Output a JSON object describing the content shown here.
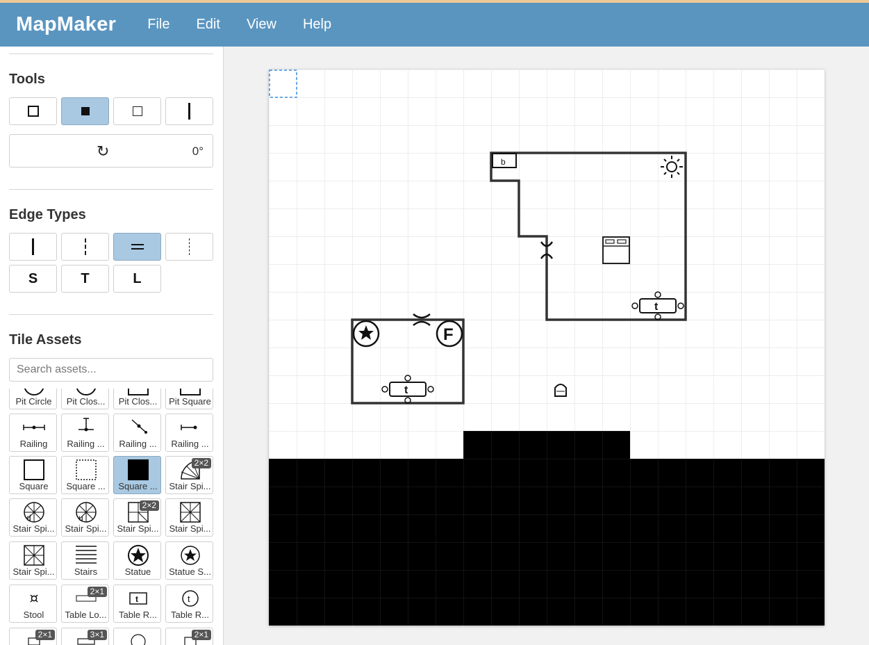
{
  "app": {
    "title": "MapMaker",
    "menu": [
      "File",
      "Edit",
      "View",
      "Help"
    ]
  },
  "sidebar": {
    "tools": {
      "title": "Tools",
      "buttons": [
        {
          "icon": "square-outline-icon",
          "active": false
        },
        {
          "icon": "square-filled-icon",
          "active": true
        },
        {
          "icon": "square-empty-icon",
          "active": false
        },
        {
          "icon": "vertical-line-icon",
          "active": false
        }
      ],
      "rotation": {
        "symbol": "↻",
        "value": "0°"
      }
    },
    "edge_types": {
      "title": "Edge Types",
      "buttons": [
        {
          "icon": "solid-edge-icon",
          "label": "",
          "active": false
        },
        {
          "icon": "dashed-edge-icon",
          "label": "",
          "active": false
        },
        {
          "icon": "double-edge-icon",
          "label": "",
          "active": true
        },
        {
          "icon": "dotted-edge-icon",
          "label": "",
          "active": false
        },
        {
          "icon": "",
          "label": "S",
          "active": false
        },
        {
          "icon": "",
          "label": "T",
          "active": false
        },
        {
          "icon": "",
          "label": "L",
          "active": false
        }
      ]
    },
    "tile_assets": {
      "title": "Tile Assets",
      "search_placeholder": "Search assets...",
      "items": [
        {
          "label": "Pit Circle",
          "icon": "pit-circle-icon",
          "badge": ""
        },
        {
          "label": "Pit Clos...",
          "icon": "pit-closed-icon",
          "badge": ""
        },
        {
          "label": "Pit Clos...",
          "icon": "pit-closed-square-icon",
          "badge": ""
        },
        {
          "label": "Pit Square",
          "icon": "pit-square-icon",
          "badge": ""
        },
        {
          "label": "Railing",
          "icon": "railing-icon",
          "badge": ""
        },
        {
          "label": "Railing ...",
          "icon": "railing-corner-icon",
          "badge": ""
        },
        {
          "label": "Railing ...",
          "icon": "railing-diagonal-icon",
          "badge": ""
        },
        {
          "label": "Railing ...",
          "icon": "railing-end-icon",
          "badge": ""
        },
        {
          "label": "Square",
          "icon": "square-icon",
          "badge": ""
        },
        {
          "label": "Square ...",
          "icon": "square-dotted-icon",
          "badge": ""
        },
        {
          "label": "Square ...",
          "icon": "square-filled-icon",
          "badge": "",
          "active": true
        },
        {
          "label": "Stair Spi...",
          "icon": "stair-spiral-quarter-icon",
          "badge": "2×2"
        },
        {
          "label": "Stair Spi...",
          "icon": "stair-spiral-down-icon",
          "badge": ""
        },
        {
          "label": "Stair Spi...",
          "icon": "stair-spiral-up-icon",
          "badge": ""
        },
        {
          "label": "Stair Spi...",
          "icon": "stair-spiral-square-icon",
          "badge": "2×2"
        },
        {
          "label": "Stair Spi...",
          "icon": "stair-spiral-square-d-icon",
          "badge": ""
        },
        {
          "label": "Stair Spi...",
          "icon": "stair-spiral-square-u-icon",
          "badge": ""
        },
        {
          "label": "Stairs",
          "icon": "stairs-icon",
          "badge": ""
        },
        {
          "label": "Statue",
          "icon": "statue-icon",
          "badge": ""
        },
        {
          "label": "Statue S...",
          "icon": "statue-small-icon",
          "badge": ""
        },
        {
          "label": "Stool",
          "icon": "stool-icon",
          "badge": ""
        },
        {
          "label": "Table Lo...",
          "icon": "table-long-icon",
          "badge": "2×1"
        },
        {
          "label": "Table R...",
          "icon": "table-rect-icon",
          "badge": ""
        },
        {
          "label": "Table R...",
          "icon": "table-round-icon",
          "badge": ""
        },
        {
          "label": "",
          "icon": "table-chairs-icon",
          "badge": "2×1"
        },
        {
          "label": "",
          "icon": "table-long-chairs-icon",
          "badge": "3×1"
        },
        {
          "label": "",
          "icon": "table-round-chairs-icon",
          "badge": ""
        },
        {
          "label": "",
          "icon": "table-rect-chairs-icon",
          "badge": "2×1"
        }
      ]
    }
  },
  "map": {
    "tile_labels": {
      "table_a": "t",
      "table_b": "t",
      "bed": "b",
      "fountain": "F"
    }
  },
  "colors": {
    "menubar": "#5a95c0",
    "active": "#a9c9e2",
    "selection": "#3b8de0"
  }
}
